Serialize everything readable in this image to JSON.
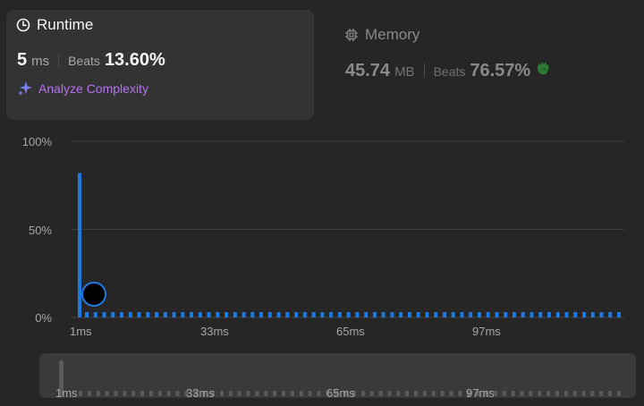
{
  "runtime": {
    "title": "Runtime",
    "icon": "clock-icon",
    "value": "5",
    "unit": "ms",
    "beats_label": "Beats",
    "beats_value": "13.60%",
    "analyze_label": "Analyze Complexity"
  },
  "memory": {
    "title": "Memory",
    "icon": "chip-icon",
    "value": "45.74",
    "unit": "MB",
    "beats_label": "Beats",
    "beats_value": "76.57%"
  },
  "chart_data": {
    "type": "bar",
    "y_ticks": [
      "100%",
      "50%",
      "0%"
    ],
    "x_ticks": [
      "1ms",
      "33ms",
      "65ms",
      "97ms"
    ],
    "ylim": [
      0,
      100
    ],
    "first_bar": {
      "x": 1,
      "value": 82
    },
    "tail_value": 2,
    "tail_count": 62,
    "marker_x": "5ms",
    "bar_color": "#1f7ae0",
    "grid": true
  },
  "minimap": {
    "x_ticks": [
      "1ms",
      "33ms",
      "65ms",
      "97ms"
    ]
  }
}
